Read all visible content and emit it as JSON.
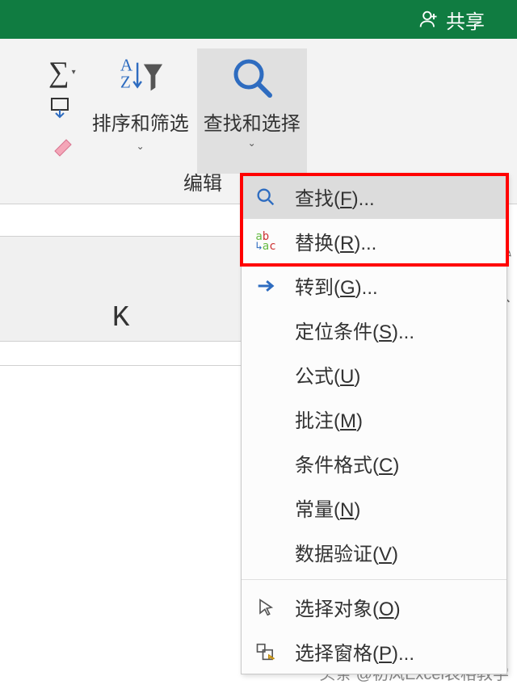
{
  "titlebar": {
    "share": "共享"
  },
  "ribbon": {
    "group_label": "编辑",
    "sort_filter": "排序和筛选",
    "find_select": "查找和选择"
  },
  "menu": {
    "find": "查找(F)...",
    "replace": "替换(R)...",
    "goto": "转到(G)...",
    "special": "定位条件(S)...",
    "formulas": "公式(U)",
    "comments": "批注(M)",
    "cond_fmt": "条件格式(C)",
    "constants": "常量(N)",
    "datavalid": "数据验证(V)",
    "sel_objects": "选择对象(O)",
    "sel_pane": "选择窗格(P)..."
  },
  "sheet": {
    "col": "K"
  },
  "watermark": "头条 @初风Excel表格教学"
}
